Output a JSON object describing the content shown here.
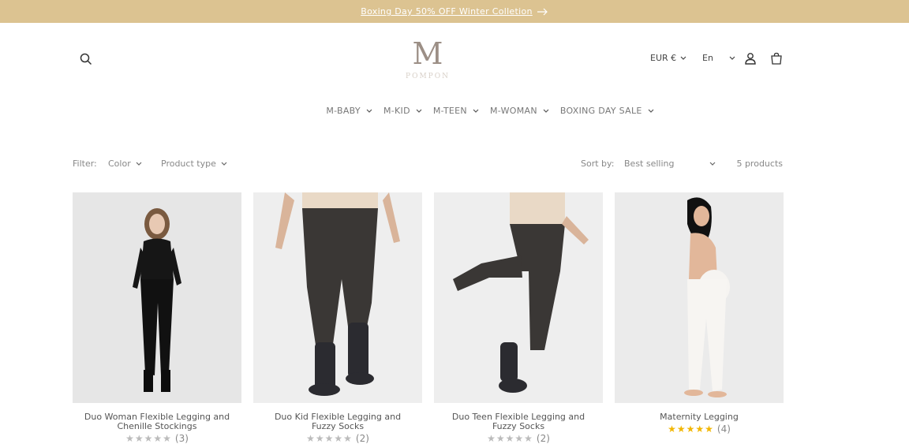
{
  "announcement": {
    "text": "Boxing Day 50% OFF Winter Colletion"
  },
  "logo": {
    "mark": "M",
    "word": "POMPON"
  },
  "header": {
    "currency": "EUR €",
    "language": "En"
  },
  "nav": {
    "items": [
      {
        "label": "M-BABY"
      },
      {
        "label": "M-KID"
      },
      {
        "label": "M-TEEN"
      },
      {
        "label": "M-WOMAN"
      },
      {
        "label": "BOXING DAY SALE"
      }
    ]
  },
  "filters": {
    "label": "Filter:",
    "color": "Color",
    "product_type": "Product type",
    "sort_label": "Sort by:",
    "sort_value": "Best selling",
    "count": "5 products"
  },
  "products": [
    {
      "title": "Duo Woman Flexible Legging and Chenille Stockings",
      "stars": "★★★★★",
      "count": "(3)"
    },
    {
      "title": "Duo Kid Flexible Legging and Fuzzy Socks",
      "stars": "★★★★★",
      "count": "(2)"
    },
    {
      "title": "Duo Teen Flexible Legging and Fuzzy Socks",
      "stars": "★★★★★",
      "count": "(2)"
    },
    {
      "title": "Maternity Legging",
      "stars": "★★★★★",
      "count": "(4)"
    }
  ],
  "colors": {
    "announcement_bg": "#dcc391",
    "star": "#f2b600"
  }
}
